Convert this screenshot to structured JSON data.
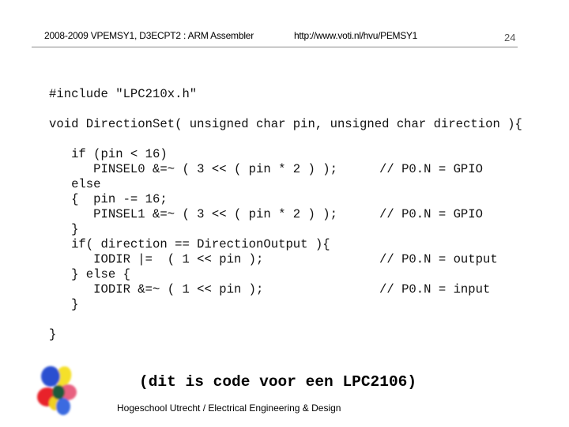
{
  "header": {
    "course_title": "2008-2009 VPEMSY1, D3ECPT2 : ARM Assembler",
    "url": "http://www.voti.nl/hvu/PEMSY1",
    "page_number": "24"
  },
  "code": {
    "lines": [
      {
        "text": "#include \"LPC210x.h\"",
        "comment": ""
      },
      {
        "text": "",
        "comment": ""
      },
      {
        "text": "void DirectionSet( unsigned char pin, unsigned char direction ){",
        "comment": ""
      },
      {
        "text": "",
        "comment": ""
      },
      {
        "text": "   if (pin < 16)",
        "comment": ""
      },
      {
        "text": "      PINSEL0 &=~ ( 3 << ( pin * 2 ) );",
        "comment": "// P0.N = GPIO"
      },
      {
        "text": "   else",
        "comment": ""
      },
      {
        "text": "   {  pin -= 16;",
        "comment": ""
      },
      {
        "text": "      PINSEL1 &=~ ( 3 << ( pin * 2 ) );",
        "comment": "// P0.N = GPIO"
      },
      {
        "text": "   }",
        "comment": ""
      },
      {
        "text": "   if( direction == DirectionOutput ){",
        "comment": ""
      },
      {
        "text": "      IODIR |=  ( 1 << pin );",
        "comment": "// P0.N = output"
      },
      {
        "text": "   } else {",
        "comment": ""
      },
      {
        "text": "      IODIR &=~ ( 1 << pin );",
        "comment": "// P0.N = input"
      },
      {
        "text": "   }",
        "comment": ""
      },
      {
        "text": "",
        "comment": ""
      },
      {
        "text": "}",
        "comment": ""
      }
    ]
  },
  "caption": "(dit is code voor een LPC2106)",
  "footer": {
    "institution": "Hogeschool Utrecht / Electrical Engineering & Design",
    "logo_icon": "hu-flower-logo-icon"
  },
  "colors": {
    "rule": "#888888",
    "page_number": "#555555",
    "logo_blue": "#2a4fd0",
    "logo_yellow": "#f5e02a",
    "logo_red": "#e8202a",
    "logo_pink": "#e86080",
    "logo_green": "#1a6a3a"
  }
}
